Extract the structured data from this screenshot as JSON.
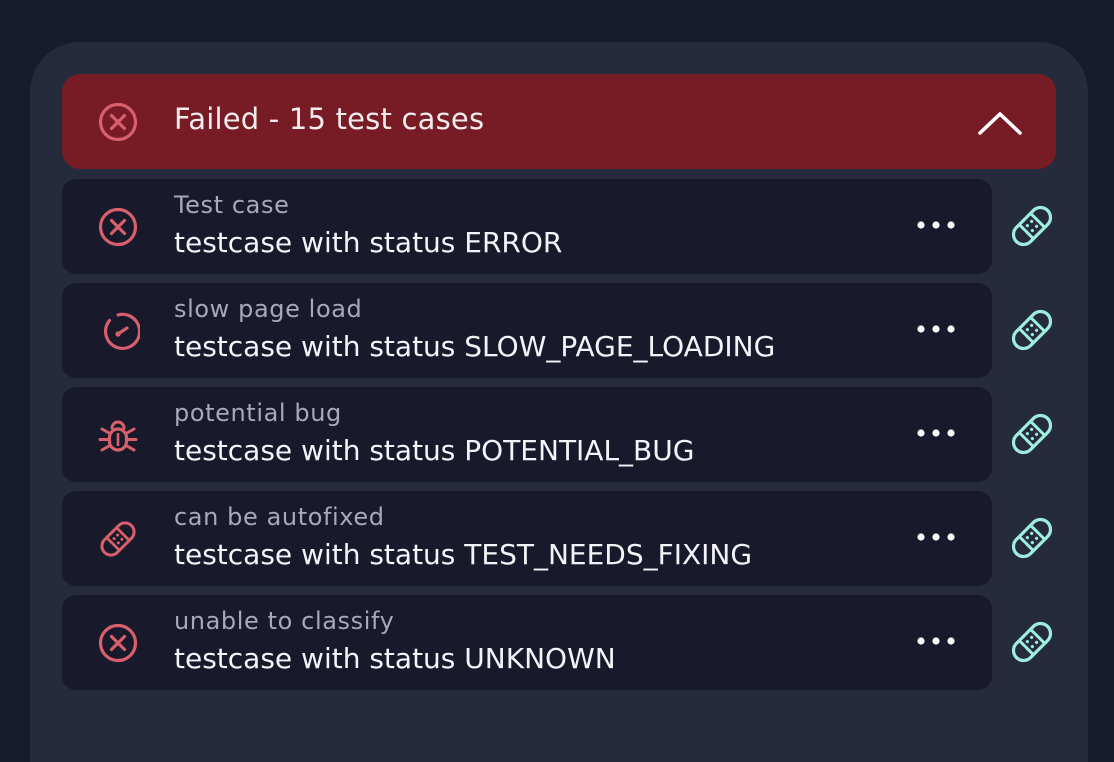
{
  "group": {
    "title": "Failed - 15 test cases",
    "status_icon": "error-circle-icon",
    "toggle_icon": "chevron-up-icon",
    "accent_color": "#771c24"
  },
  "testcases": [
    {
      "category": "Test case",
      "title": "testcase with status ERROR",
      "icon": "error-circle-icon"
    },
    {
      "category": "slow page load",
      "title": "testcase with status SLOW_PAGE_LOADING",
      "icon": "speedometer-icon"
    },
    {
      "category": "potential bug",
      "title": "testcase with status POTENTIAL_BUG",
      "icon": "bug-icon"
    },
    {
      "category": "can be autofixed",
      "title": "testcase with status TEST_NEEDS_FIXING",
      "icon": "bandage-icon"
    },
    {
      "category": "unable to classify",
      "title": "testcase with status UNKNOWN",
      "icon": "error-circle-icon"
    }
  ],
  "row_actions": {
    "more_icon": "more-horizontal-icon",
    "fix_icon": "bandage-icon"
  },
  "colors": {
    "background": "#181b2c",
    "panel": "#262a3d",
    "row": "#181a2b",
    "status_icon": "#d8606c",
    "fix_icon": "#9eeedd",
    "text_primary": "#f4f4f8",
    "text_secondary": "#a7a9b8"
  }
}
